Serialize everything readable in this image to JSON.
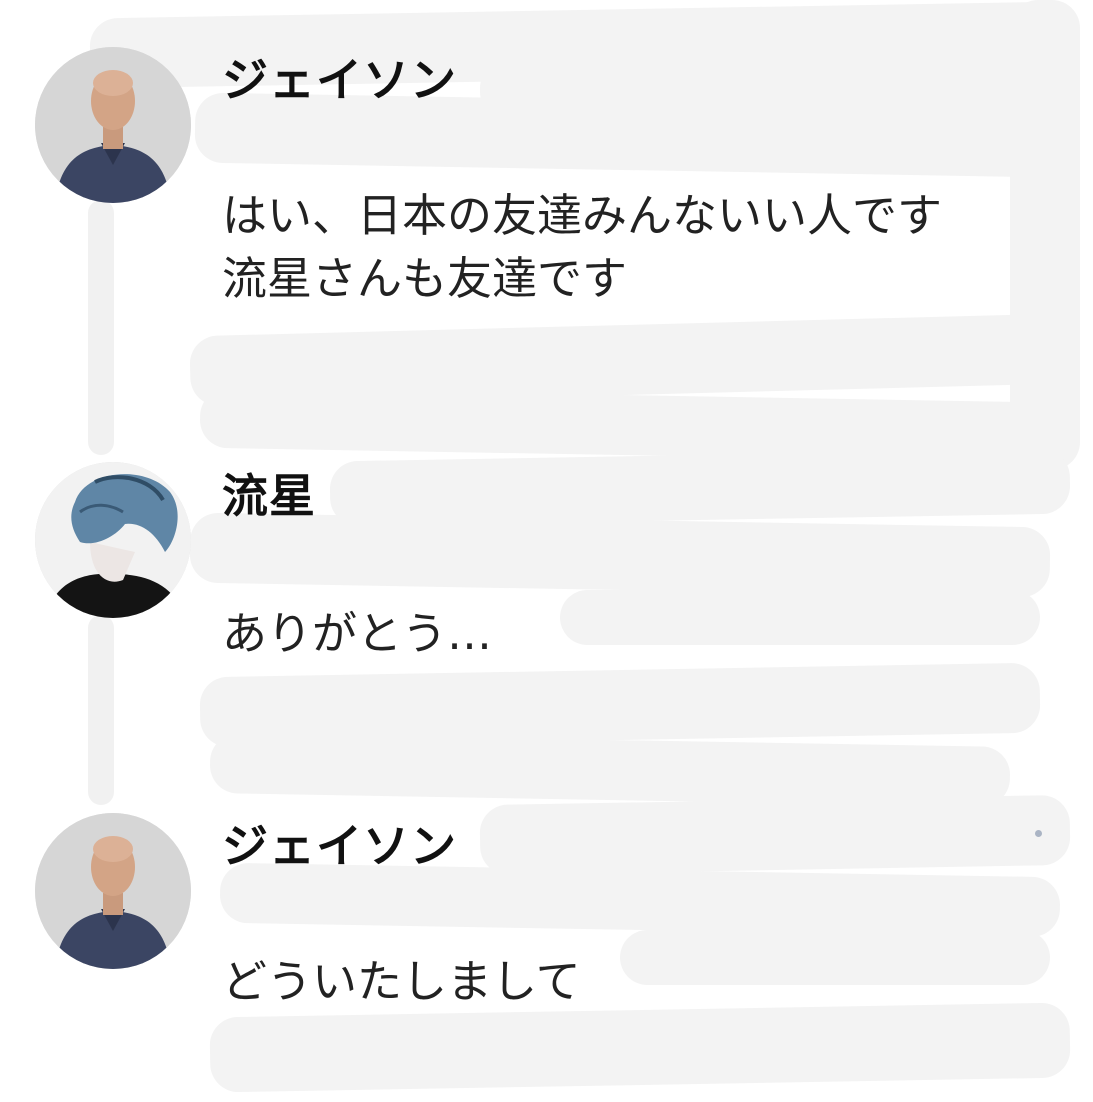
{
  "messages": [
    {
      "author": "ジェイソン",
      "avatar": "bald-man-in-navy-shirt-avatar",
      "text": "はい、日本の友達みんないい人です\n流星さんも友達です"
    },
    {
      "author": "流星",
      "avatar": "anime-boy-blue-hair-avatar",
      "text": "ありがとう…"
    },
    {
      "author": "ジェイソン",
      "avatar": "bald-man-in-navy-shirt-avatar",
      "text": "どういたしまして"
    }
  ],
  "colors": {
    "background": "#ffffff",
    "scribble": "#f3f3f3",
    "text": "#222222"
  }
}
